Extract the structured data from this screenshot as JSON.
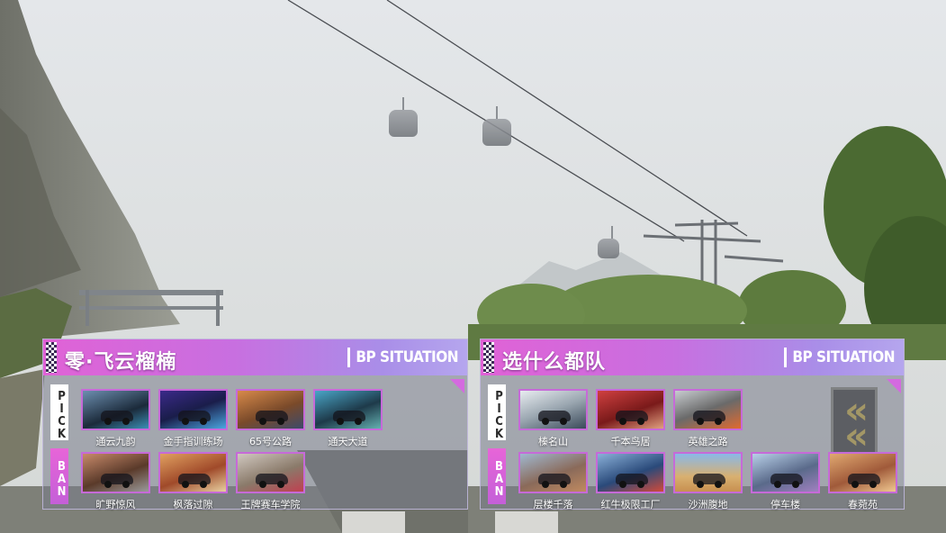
{
  "header_tag": "BP SITUATION",
  "labels": {
    "pick": "PICK",
    "ban": "BAN"
  },
  "colors": {
    "accent": "#d46ae0",
    "header_start": "#e062d6",
    "header_end": "#b5a6ee",
    "card_border": "#c66ad8"
  },
  "teams": [
    {
      "name": "零·飞云榴楠",
      "picks": [
        "通云九韵",
        "金手指训练场",
        "65号公路",
        "通天大道"
      ],
      "bans": [
        "旷野惊风",
        "枫落过隙",
        "王牌赛车学院"
      ]
    },
    {
      "name": "选什么都队",
      "picks": [
        "榛名山",
        "千本鸟居",
        "英雄之路"
      ],
      "bans": [
        "层楼千落",
        "红牛极限工厂",
        "沙洲腹地",
        "停车楼",
        "春菀苑"
      ]
    }
  ]
}
